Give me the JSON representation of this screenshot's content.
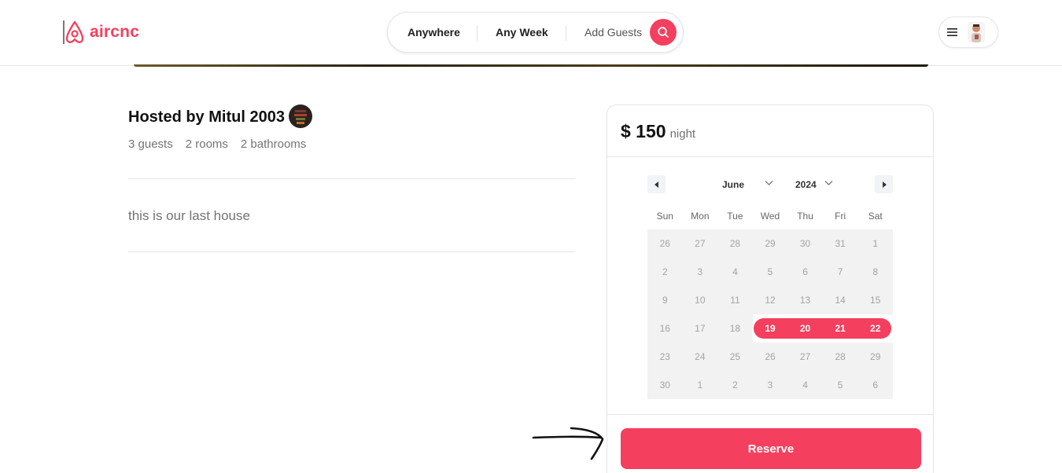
{
  "brand": {
    "name": "aircnc",
    "accent": "#f43f5e"
  },
  "search": {
    "anywhere": "Anywhere",
    "week": "Any Week",
    "guests": "Add Guests",
    "icon": "search-icon"
  },
  "user_menu": {
    "menu_icon": "hamburger-icon",
    "avatar": "user-avatar"
  },
  "listing": {
    "host_title": "Hosted by Mitul 2003",
    "stats": [
      "3 guests",
      "2 rooms",
      "2 bathrooms"
    ],
    "description": "this is our last house"
  },
  "reserve": {
    "price": "$ 150",
    "per": "night",
    "button": "Reserve"
  },
  "calendar": {
    "month": "June",
    "year": "2024",
    "weekdays": [
      "Sun",
      "Mon",
      "Tue",
      "Wed",
      "Thu",
      "Fri",
      "Sat"
    ],
    "days": [
      "26",
      "27",
      "28",
      "29",
      "30",
      "31",
      "1",
      "2",
      "3",
      "4",
      "5",
      "6",
      "7",
      "8",
      "9",
      "10",
      "11",
      "12",
      "13",
      "14",
      "15",
      "16",
      "17",
      "18",
      "19",
      "20",
      "21",
      "22",
      "23",
      "24",
      "25",
      "26",
      "27",
      "28",
      "29",
      "30",
      "1",
      "2",
      "3",
      "4",
      "5",
      "6"
    ],
    "selected_range": [
      "19",
      "22"
    ]
  }
}
